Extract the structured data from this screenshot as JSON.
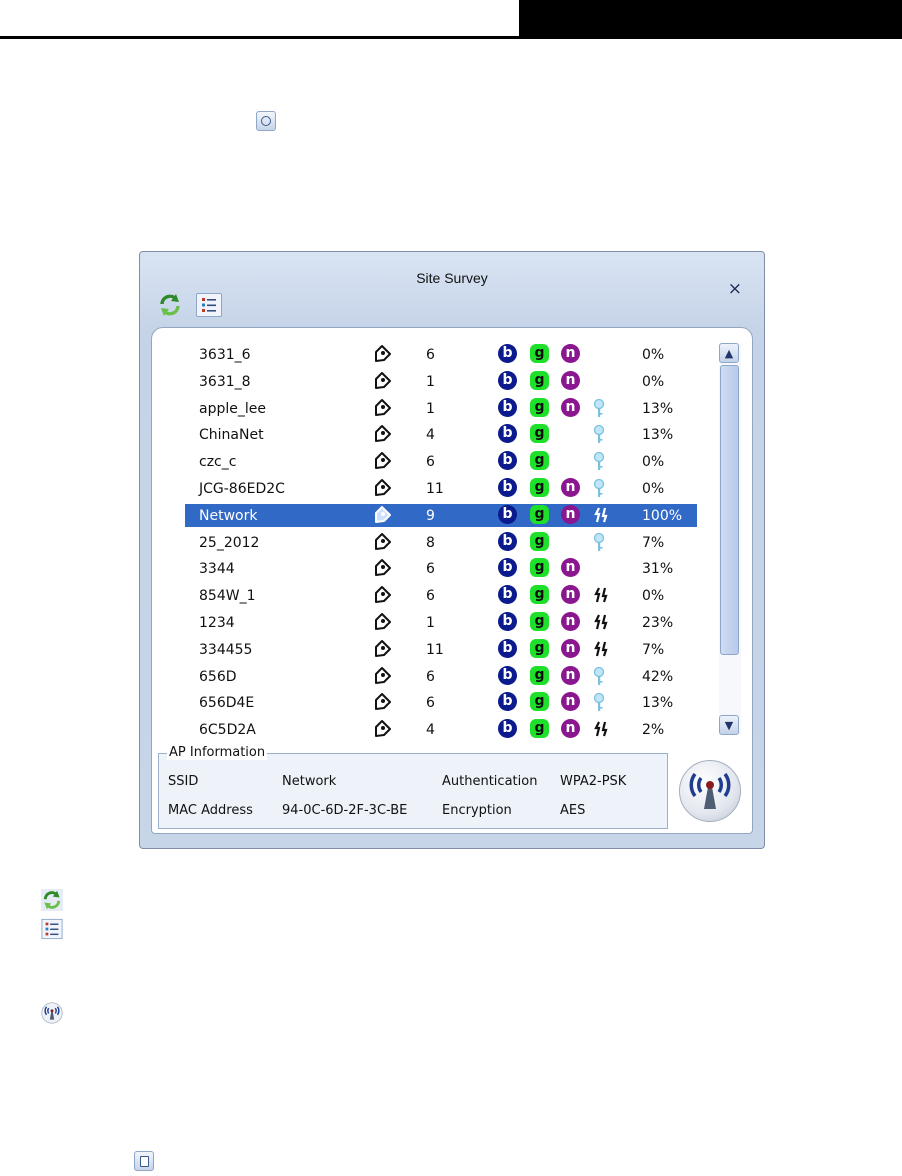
{
  "window": {
    "title": "Site Survey",
    "close_label": "×"
  },
  "toolbar": {
    "refresh_icon": "refresh-icon",
    "list_icon": "list-icon"
  },
  "networks": [
    {
      "ssid": "3631_6",
      "channel": "6",
      "modes": [
        "b",
        "g",
        "n"
      ],
      "security": "",
      "signal": "0%"
    },
    {
      "ssid": "3631_8",
      "channel": "1",
      "modes": [
        "b",
        "g",
        "n"
      ],
      "security": "",
      "signal": "0%"
    },
    {
      "ssid": "apple_lee",
      "channel": "1",
      "modes": [
        "b",
        "g",
        "n"
      ],
      "security": "key",
      "signal": "13%"
    },
    {
      "ssid": "ChinaNet",
      "channel": "4",
      "modes": [
        "b",
        "g"
      ],
      "security": "key",
      "signal": "13%"
    },
    {
      "ssid": "czc_c",
      "channel": "6",
      "modes": [
        "b",
        "g"
      ],
      "security": "key",
      "signal": "0%"
    },
    {
      "ssid": "JCG-86ED2C",
      "channel": "11",
      "modes": [
        "b",
        "g",
        "n"
      ],
      "security": "key",
      "signal": "0%"
    },
    {
      "ssid": "Network",
      "channel": "9",
      "modes": [
        "b",
        "g",
        "n"
      ],
      "security": "wps",
      "signal": "100%",
      "selected": true
    },
    {
      "ssid": "25_2012",
      "channel": "8",
      "modes": [
        "b",
        "g"
      ],
      "security": "key",
      "signal": "7%"
    },
    {
      "ssid": "3344",
      "channel": "6",
      "modes": [
        "b",
        "g",
        "n"
      ],
      "security": "",
      "signal": "31%"
    },
    {
      "ssid": "854W_1",
      "channel": "6",
      "modes": [
        "b",
        "g",
        "n"
      ],
      "security": "wps",
      "signal": "0%"
    },
    {
      "ssid": "1234",
      "channel": "1",
      "modes": [
        "b",
        "g",
        "n"
      ],
      "security": "wps",
      "signal": "23%"
    },
    {
      "ssid": "334455",
      "channel": "11",
      "modes": [
        "b",
        "g",
        "n"
      ],
      "security": "wps",
      "signal": "7%"
    },
    {
      "ssid": "656D",
      "channel": "6",
      "modes": [
        "b",
        "g",
        "n"
      ],
      "security": "key",
      "signal": "42%"
    },
    {
      "ssid": "656D4E",
      "channel": "6",
      "modes": [
        "b",
        "g",
        "n"
      ],
      "security": "key",
      "signal": "13%"
    },
    {
      "ssid": "6C5D2A",
      "channel": "4",
      "modes": [
        "b",
        "g",
        "n"
      ],
      "security": "wps",
      "signal": "2%"
    }
  ],
  "ap_info": {
    "legend": "AP Information",
    "ssid_label": "SSID",
    "ssid_value": "Network",
    "mac_label": "MAC Address",
    "mac_value": "94-0C-6D-2F-3C-BE",
    "auth_label": "Authentication",
    "auth_value": "WPA2-PSK",
    "enc_label": "Encryption",
    "enc_value": "AES"
  },
  "connect_icon": "wireless-connect-icon",
  "colors": {
    "selection": "#3169c6",
    "mode_b": "#0b1a8c",
    "mode_g": "#1ee02b",
    "mode_n": "#8a1690"
  }
}
